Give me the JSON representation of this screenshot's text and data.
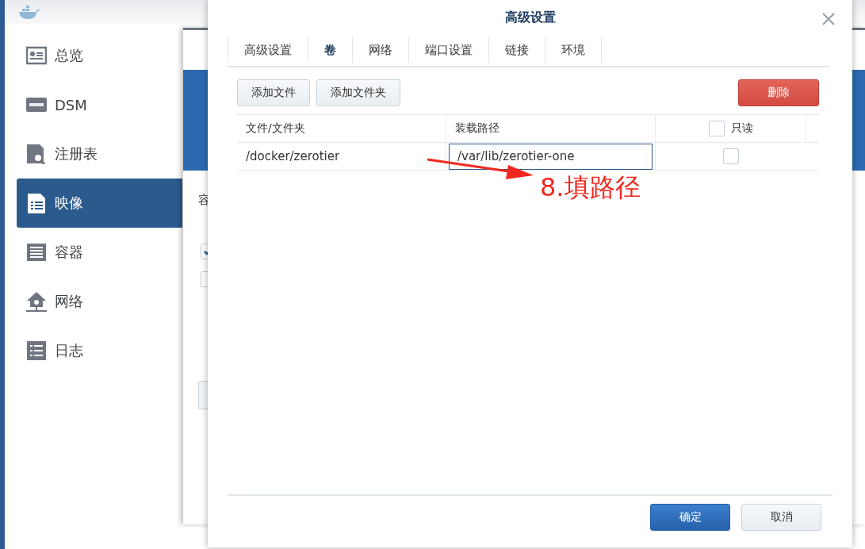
{
  "sidebar": {
    "items": [
      {
        "label": "总览",
        "selected": false
      },
      {
        "label": "DSM",
        "selected": false
      },
      {
        "label": "注册表",
        "selected": false
      },
      {
        "label": "映像",
        "selected": true
      },
      {
        "label": "容器",
        "selected": false
      },
      {
        "label": "网络",
        "selected": false
      },
      {
        "label": "日志",
        "selected": false
      }
    ]
  },
  "background_window": {
    "label": "容",
    "checkboxes": [
      {
        "checked": true
      },
      {
        "checked": false
      }
    ]
  },
  "dialog": {
    "title": "高级设置",
    "tabs": [
      {
        "label": "高级设置",
        "selected": false
      },
      {
        "label": "卷",
        "selected": true
      },
      {
        "label": "网络",
        "selected": false
      },
      {
        "label": "端口设置",
        "selected": false
      },
      {
        "label": "链接",
        "selected": false
      },
      {
        "label": "环境",
        "selected": false
      }
    ],
    "toolbar": {
      "buttons": [
        "添加文件",
        "添加文件夹"
      ],
      "delete_button": "删除"
    },
    "table": {
      "columns": [
        "文件/文件夹",
        "装载路径",
        "只读"
      ],
      "readonly_all_checked": false,
      "rows": [
        {
          "file": "/docker/zerotier",
          "mount_path": "/var/lib/zerotier-one",
          "readonly": false
        }
      ]
    },
    "annotation": "8.填路径",
    "footer": {
      "ok": "确定",
      "cancel": "取消"
    }
  }
}
